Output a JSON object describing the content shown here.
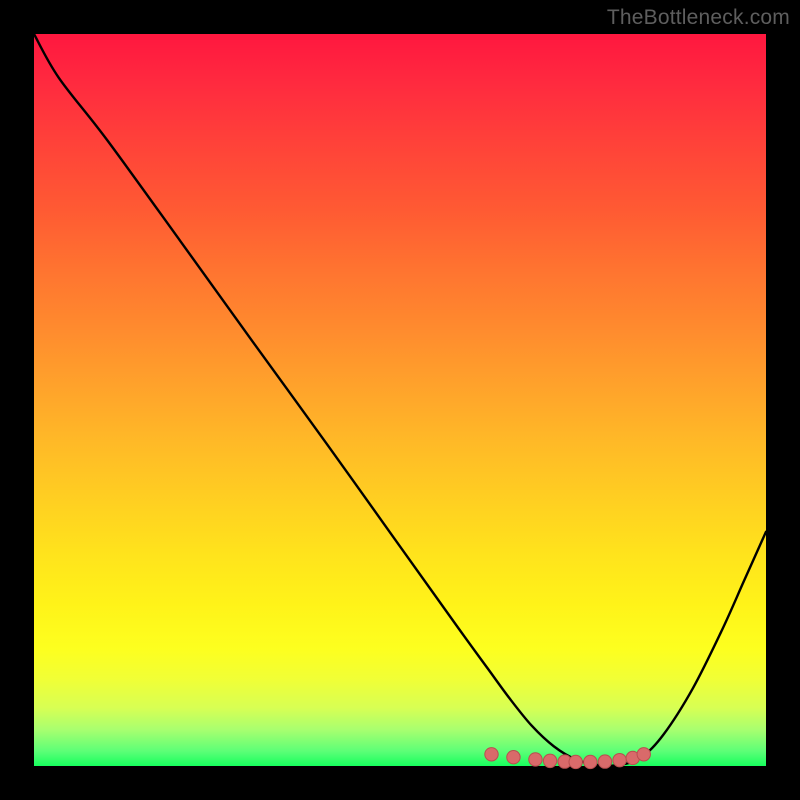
{
  "attribution": "TheBottleneck.com",
  "colors": {
    "background": "#000000",
    "curve": "#000000",
    "marker_fill": "#d96a6a",
    "marker_stroke": "#b84f4f"
  },
  "chart_data": {
    "type": "line",
    "title": "",
    "xlabel": "",
    "ylabel": "",
    "xlim": [
      0,
      100
    ],
    "ylim": [
      0,
      100
    ],
    "x": [
      0,
      3.4,
      10,
      20,
      30,
      40,
      50,
      58,
      62,
      65,
      68,
      71,
      74,
      77,
      80,
      83,
      86,
      90,
      94,
      97,
      100
    ],
    "values": [
      100,
      94,
      85.5,
      71.7,
      57.8,
      44,
      30,
      18.8,
      13.3,
      9.2,
      5.5,
      2.7,
      0.9,
      0.15,
      0.15,
      1.2,
      4.3,
      10.6,
      18.6,
      25.3,
      32
    ],
    "markers": {
      "x": [
        62.5,
        65.5,
        68.5,
        70.5,
        72.5,
        74,
        76,
        78,
        80,
        81.8,
        83.3
      ],
      "y": [
        1.6,
        1.2,
        0.9,
        0.7,
        0.6,
        0.55,
        0.55,
        0.6,
        0.8,
        1.1,
        1.6
      ]
    }
  }
}
